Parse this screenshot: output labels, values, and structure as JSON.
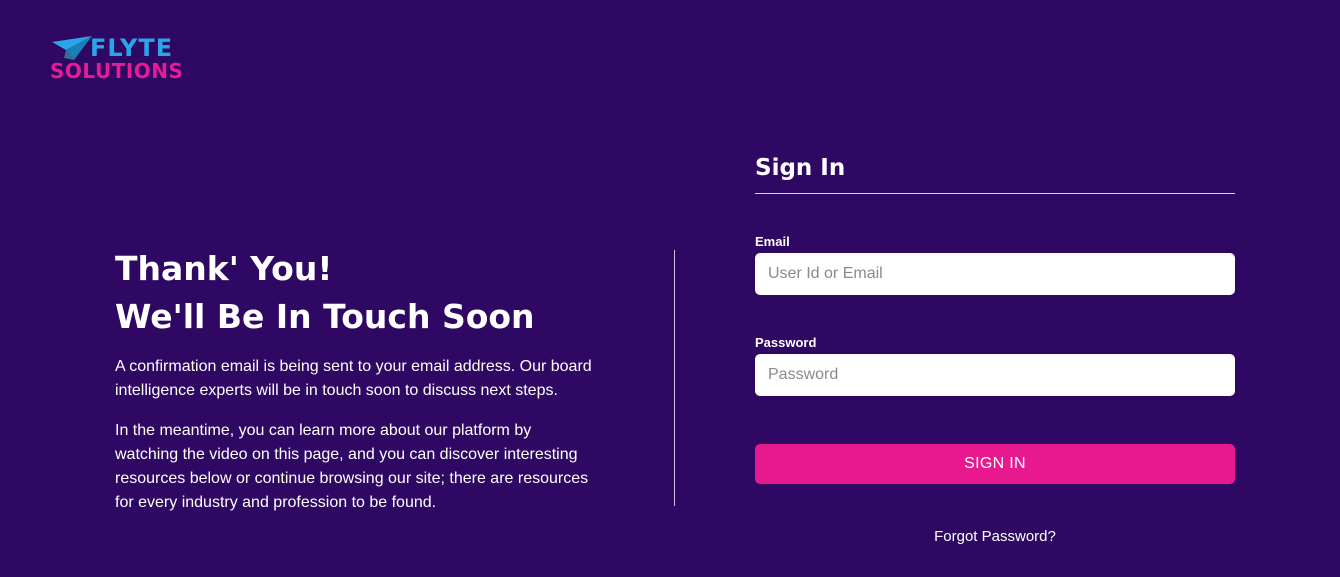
{
  "brand": {
    "logo_line_1": "FLYTE",
    "logo_line_2": "SOLUTIONS",
    "colors": {
      "blue": "#2aa6e8",
      "pink": "#e51c95",
      "background": "#2e0862"
    }
  },
  "confirmation": {
    "heading_line_1": "Thank' You!",
    "heading_line_2": "We'll Be In Touch Soon",
    "paragraph_1": "A confirmation email is being sent to your email address. Our board intelligence experts will be in touch soon to discuss next steps.",
    "paragraph_2": "In the meantime, you can learn more about our platform by watching the video on this page, and you can discover interesting resources below or continue browsing our site; there are resources for every industry and profession to be found."
  },
  "signin": {
    "title": "Sign In",
    "email_label": "Email",
    "email_value": "",
    "email_placeholder": "User Id or Email",
    "password_label": "Password",
    "password_value": "",
    "password_placeholder": "Password",
    "submit_label": "SIGN IN",
    "submit_color": "#e8198f",
    "forgot_label": "Forgot Password?"
  },
  "icons": {
    "logo_mark": "paper-plane-icon"
  }
}
